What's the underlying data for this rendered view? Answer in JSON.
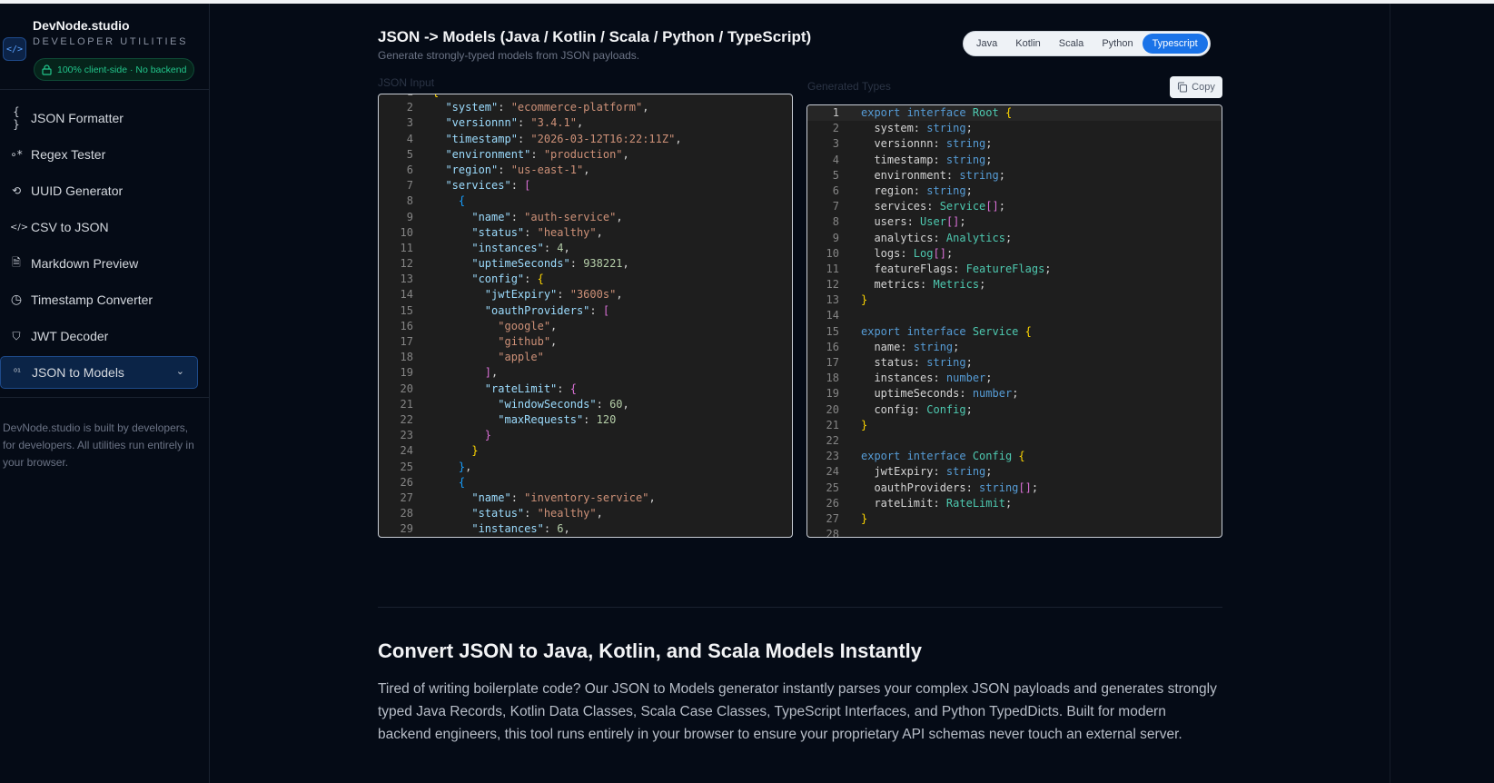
{
  "brand": {
    "name": "DevNode.studio",
    "subtitle": "DEVELOPER UTILITIES",
    "logo_icon": "</>",
    "badge": "100% client-side · No backend"
  },
  "sidebar": {
    "items": [
      {
        "label": "JSON Formatter",
        "icon": "{ }"
      },
      {
        "label": "Regex Tester",
        "icon": "∘*"
      },
      {
        "label": "UUID Generator",
        "icon": "⟲"
      },
      {
        "label": "CSV to JSON",
        "icon": "</>"
      },
      {
        "label": "Markdown Preview",
        "icon": "🗎"
      },
      {
        "label": "Timestamp Converter",
        "icon": "◷"
      },
      {
        "label": "JWT Decoder",
        "icon": "⛉"
      },
      {
        "label": "JSON to Models",
        "icon": "⁰¹",
        "active": true
      }
    ],
    "about": "DevNode.studio is built by developers, for developers. All utilities run entirely in your browser."
  },
  "header": {
    "title": "JSON -> Models (Java / Kotlin / Scala / Python / TypeScript)",
    "subtitle": "Generate strongly-typed models from JSON payloads.",
    "languages": [
      "Java",
      "Kotlin",
      "Scala",
      "Python",
      "Typescript"
    ],
    "selected_language": "Typescript"
  },
  "input": {
    "label": "JSON Input",
    "lines": [
      [
        [
          "b1",
          "{"
        ]
      ],
      [
        [
          "p",
          "  "
        ],
        [
          "k",
          "\"system\""
        ],
        [
          "p",
          ": "
        ],
        [
          "s",
          "\"ecommerce-platform\""
        ],
        [
          "p",
          ","
        ]
      ],
      [
        [
          "p",
          "  "
        ],
        [
          "k",
          "\"versionnn\""
        ],
        [
          "p",
          ": "
        ],
        [
          "s",
          "\"3.4.1\""
        ],
        [
          "p",
          ","
        ]
      ],
      [
        [
          "p",
          "  "
        ],
        [
          "k",
          "\"timestamp\""
        ],
        [
          "p",
          ": "
        ],
        [
          "s",
          "\"2026-03-12T16:22:11Z\""
        ],
        [
          "p",
          ","
        ]
      ],
      [
        [
          "p",
          "  "
        ],
        [
          "k",
          "\"environment\""
        ],
        [
          "p",
          ": "
        ],
        [
          "s",
          "\"production\""
        ],
        [
          "p",
          ","
        ]
      ],
      [
        [
          "p",
          "  "
        ],
        [
          "k",
          "\"region\""
        ],
        [
          "p",
          ": "
        ],
        [
          "s",
          "\"us-east-1\""
        ],
        [
          "p",
          ","
        ]
      ],
      [
        [
          "p",
          "  "
        ],
        [
          "k",
          "\"services\""
        ],
        [
          "p",
          ": "
        ],
        [
          "b2",
          "["
        ]
      ],
      [
        [
          "p",
          "    "
        ],
        [
          "b3",
          "{"
        ]
      ],
      [
        [
          "p",
          "      "
        ],
        [
          "k",
          "\"name\""
        ],
        [
          "p",
          ": "
        ],
        [
          "s",
          "\"auth-service\""
        ],
        [
          "p",
          ","
        ]
      ],
      [
        [
          "p",
          "      "
        ],
        [
          "k",
          "\"status\""
        ],
        [
          "p",
          ": "
        ],
        [
          "s",
          "\"healthy\""
        ],
        [
          "p",
          ","
        ]
      ],
      [
        [
          "p",
          "      "
        ],
        [
          "k",
          "\"instances\""
        ],
        [
          "p",
          ": "
        ],
        [
          "n",
          "4"
        ],
        [
          "p",
          ","
        ]
      ],
      [
        [
          "p",
          "      "
        ],
        [
          "k",
          "\"uptimeSeconds\""
        ],
        [
          "p",
          ": "
        ],
        [
          "n",
          "938221"
        ],
        [
          "p",
          ","
        ]
      ],
      [
        [
          "p",
          "      "
        ],
        [
          "k",
          "\"config\""
        ],
        [
          "p",
          ": "
        ],
        [
          "b1",
          "{"
        ]
      ],
      [
        [
          "p",
          "        "
        ],
        [
          "k",
          "\"jwtExpiry\""
        ],
        [
          "p",
          ": "
        ],
        [
          "s",
          "\"3600s\""
        ],
        [
          "p",
          ","
        ]
      ],
      [
        [
          "p",
          "        "
        ],
        [
          "k",
          "\"oauthProviders\""
        ],
        [
          "p",
          ": "
        ],
        [
          "b2",
          "["
        ]
      ],
      [
        [
          "p",
          "          "
        ],
        [
          "s",
          "\"google\""
        ],
        [
          "p",
          ","
        ]
      ],
      [
        [
          "p",
          "          "
        ],
        [
          "s",
          "\"github\""
        ],
        [
          "p",
          ","
        ]
      ],
      [
        [
          "p",
          "          "
        ],
        [
          "s",
          "\"apple\""
        ]
      ],
      [
        [
          "p",
          "        "
        ],
        [
          "b2",
          "]"
        ],
        [
          "p",
          ","
        ]
      ],
      [
        [
          "p",
          "        "
        ],
        [
          "k",
          "\"rateLimit\""
        ],
        [
          "p",
          ": "
        ],
        [
          "b2",
          "{"
        ]
      ],
      [
        [
          "p",
          "          "
        ],
        [
          "k",
          "\"windowSeconds\""
        ],
        [
          "p",
          ": "
        ],
        [
          "n",
          "60"
        ],
        [
          "p",
          ","
        ]
      ],
      [
        [
          "p",
          "          "
        ],
        [
          "k",
          "\"maxRequests\""
        ],
        [
          "p",
          ": "
        ],
        [
          "n",
          "120"
        ]
      ],
      [
        [
          "p",
          "        "
        ],
        [
          "b2",
          "}"
        ]
      ],
      [
        [
          "p",
          "      "
        ],
        [
          "b1",
          "}"
        ]
      ],
      [
        [
          "p",
          "    "
        ],
        [
          "b3",
          "}"
        ],
        [
          "p",
          ","
        ]
      ],
      [
        [
          "p",
          "    "
        ],
        [
          "b3",
          "{"
        ]
      ],
      [
        [
          "p",
          "      "
        ],
        [
          "k",
          "\"name\""
        ],
        [
          "p",
          ": "
        ],
        [
          "s",
          "\"inventory-service\""
        ],
        [
          "p",
          ","
        ]
      ],
      [
        [
          "p",
          "      "
        ],
        [
          "k",
          "\"status\""
        ],
        [
          "p",
          ": "
        ],
        [
          "s",
          "\"healthy\""
        ],
        [
          "p",
          ","
        ]
      ],
      [
        [
          "p",
          "      "
        ],
        [
          "k",
          "\"instances\""
        ],
        [
          "p",
          ": "
        ],
        [
          "n",
          "6"
        ],
        [
          "p",
          ","
        ]
      ]
    ]
  },
  "output": {
    "label": "Generated Types",
    "copy_label": "Copy",
    "lines": [
      [
        [
          "kw",
          "export interface "
        ],
        [
          "ty",
          "Root "
        ],
        [
          "b1",
          "{"
        ]
      ],
      [
        [
          "pr",
          "  system: "
        ],
        [
          "kw",
          "string"
        ],
        [
          "pr",
          ";"
        ]
      ],
      [
        [
          "pr",
          "  versionnn: "
        ],
        [
          "kw",
          "string"
        ],
        [
          "pr",
          ";"
        ]
      ],
      [
        [
          "pr",
          "  timestamp: "
        ],
        [
          "kw",
          "string"
        ],
        [
          "pr",
          ";"
        ]
      ],
      [
        [
          "pr",
          "  environment: "
        ],
        [
          "kw",
          "string"
        ],
        [
          "pr",
          ";"
        ]
      ],
      [
        [
          "pr",
          "  region: "
        ],
        [
          "kw",
          "string"
        ],
        [
          "pr",
          ";"
        ]
      ],
      [
        [
          "pr",
          "  services: "
        ],
        [
          "ty",
          "Service"
        ],
        [
          "b2",
          "[]"
        ],
        [
          "pr",
          ";"
        ]
      ],
      [
        [
          "pr",
          "  users: "
        ],
        [
          "ty",
          "User"
        ],
        [
          "b2",
          "[]"
        ],
        [
          "pr",
          ";"
        ]
      ],
      [
        [
          "pr",
          "  analytics: "
        ],
        [
          "ty",
          "Analytics"
        ],
        [
          "pr",
          ";"
        ]
      ],
      [
        [
          "pr",
          "  logs: "
        ],
        [
          "ty",
          "Log"
        ],
        [
          "b2",
          "[]"
        ],
        [
          "pr",
          ";"
        ]
      ],
      [
        [
          "pr",
          "  featureFlags: "
        ],
        [
          "ty",
          "FeatureFlags"
        ],
        [
          "pr",
          ";"
        ]
      ],
      [
        [
          "pr",
          "  metrics: "
        ],
        [
          "ty",
          "Metrics"
        ],
        [
          "pr",
          ";"
        ]
      ],
      [
        [
          "b1",
          "}"
        ]
      ],
      [
        [
          "pr",
          ""
        ]
      ],
      [
        [
          "kw",
          "export interface "
        ],
        [
          "ty",
          "Service "
        ],
        [
          "b1",
          "{"
        ]
      ],
      [
        [
          "pr",
          "  name: "
        ],
        [
          "kw",
          "string"
        ],
        [
          "pr",
          ";"
        ]
      ],
      [
        [
          "pr",
          "  status: "
        ],
        [
          "kw",
          "string"
        ],
        [
          "pr",
          ";"
        ]
      ],
      [
        [
          "pr",
          "  instances: "
        ],
        [
          "kw",
          "number"
        ],
        [
          "pr",
          ";"
        ]
      ],
      [
        [
          "pr",
          "  uptimeSeconds: "
        ],
        [
          "kw",
          "number"
        ],
        [
          "pr",
          ";"
        ]
      ],
      [
        [
          "pr",
          "  config: "
        ],
        [
          "ty",
          "Config"
        ],
        [
          "pr",
          ";"
        ]
      ],
      [
        [
          "b1",
          "}"
        ]
      ],
      [
        [
          "pr",
          ""
        ]
      ],
      [
        [
          "kw",
          "export interface "
        ],
        [
          "ty",
          "Config "
        ],
        [
          "b1",
          "{"
        ]
      ],
      [
        [
          "pr",
          "  jwtExpiry: "
        ],
        [
          "kw",
          "string"
        ],
        [
          "pr",
          ";"
        ]
      ],
      [
        [
          "pr",
          "  oauthProviders: "
        ],
        [
          "kw",
          "string"
        ],
        [
          "b2",
          "[]"
        ],
        [
          "pr",
          ";"
        ]
      ],
      [
        [
          "pr",
          "  rateLimit: "
        ],
        [
          "ty",
          "RateLimit"
        ],
        [
          "pr",
          ";"
        ]
      ],
      [
        [
          "b1",
          "}"
        ]
      ],
      [
        [
          "pr",
          ""
        ]
      ]
    ]
  },
  "article": {
    "heading": "Convert JSON to Java, Kotlin, and Scala Models Instantly",
    "body": "Tired of writing boilerplate code? Our JSON to Models generator instantly parses your complex JSON payloads and generates strongly typed Java Records, Kotlin Data Classes, Scala Case Classes, TypeScript Interfaces, and Python TypedDicts. Built for modern backend engineers, this tool runs entirely in your browser to ensure your proprietary API schemas never touch an external server."
  },
  "colors": {
    "accent": "#1a73e8",
    "badge": "#22c58b",
    "background": "#050b16",
    "editor": "#1e1e1e"
  }
}
